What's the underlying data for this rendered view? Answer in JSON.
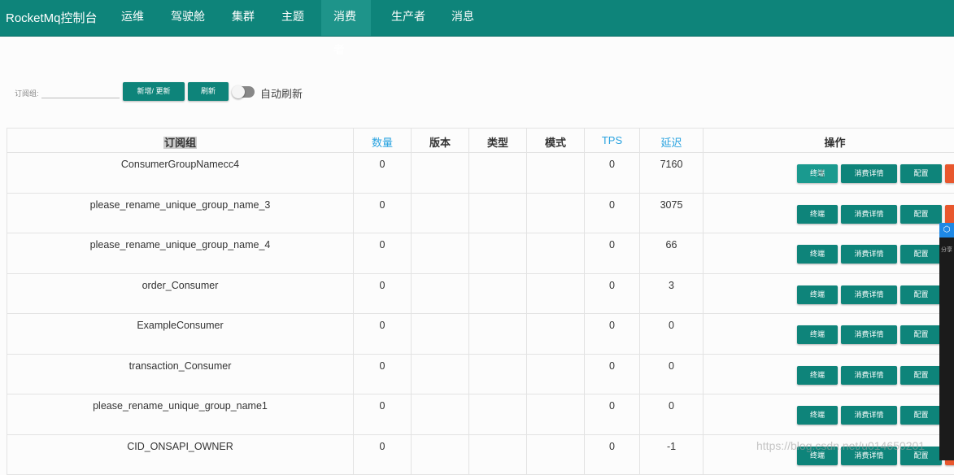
{
  "nav": {
    "brand": "RocketMq控制台",
    "items": [
      "运维",
      "驾驶舱",
      "集群",
      "主题",
      "消费者",
      "生产者",
      "消息"
    ],
    "active": "消费者"
  },
  "toolbar": {
    "label": "订阅组:",
    "input_value": "",
    "add_button": "新增/ 更新",
    "refresh_button": "刷新",
    "auto_refresh_label": "自动刷新"
  },
  "table": {
    "headers": [
      "订阅组",
      "数量",
      "版本",
      "类型",
      "模式",
      "TPS",
      "延迟",
      "操作"
    ],
    "rows": [
      {
        "group": "ConsumerGroupNamecc4",
        "count": "0",
        "version": "",
        "type": "",
        "mode": "",
        "tps": "0",
        "delay": "7160"
      },
      {
        "group": "please_rename_unique_group_name_3",
        "count": "0",
        "version": "",
        "type": "",
        "mode": "",
        "tps": "0",
        "delay": "3075"
      },
      {
        "group": "please_rename_unique_group_name_4",
        "count": "0",
        "version": "",
        "type": "",
        "mode": "",
        "tps": "0",
        "delay": "66"
      },
      {
        "group": "order_Consumer",
        "count": "0",
        "version": "",
        "type": "",
        "mode": "",
        "tps": "0",
        "delay": "3"
      },
      {
        "group": "ExampleConsumer",
        "count": "0",
        "version": "",
        "type": "",
        "mode": "",
        "tps": "0",
        "delay": "0"
      },
      {
        "group": "transaction_Consumer",
        "count": "0",
        "version": "",
        "type": "",
        "mode": "",
        "tps": "0",
        "delay": "0"
      },
      {
        "group": "please_rename_unique_group_name1",
        "count": "0",
        "version": "",
        "type": "",
        "mode": "",
        "tps": "0",
        "delay": "0"
      },
      {
        "group": "CID_ONSAPI_OWNER",
        "count": "0",
        "version": "",
        "type": "",
        "mode": "",
        "tps": "0",
        "delay": "-1"
      }
    ],
    "ops": {
      "terminal": "终端",
      "detail": "消费详情",
      "config": "配置"
    }
  },
  "side_panel": {
    "label": "分享"
  },
  "watermark": "https://blog.csdn.net/u014650201",
  "colors": {
    "primary": "#0e847a",
    "delete": "#e8572d",
    "link": "#2aa3e0"
  }
}
